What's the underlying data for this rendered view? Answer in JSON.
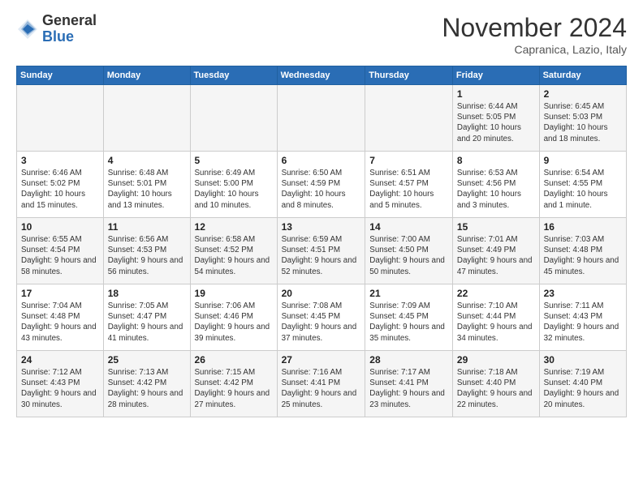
{
  "header": {
    "logo_general": "General",
    "logo_blue": "Blue",
    "month_title": "November 2024",
    "location": "Capranica, Lazio, Italy"
  },
  "days_of_week": [
    "Sunday",
    "Monday",
    "Tuesday",
    "Wednesday",
    "Thursday",
    "Friday",
    "Saturday"
  ],
  "weeks": [
    [
      {
        "day": "",
        "info": ""
      },
      {
        "day": "",
        "info": ""
      },
      {
        "day": "",
        "info": ""
      },
      {
        "day": "",
        "info": ""
      },
      {
        "day": "",
        "info": ""
      },
      {
        "day": "1",
        "info": "Sunrise: 6:44 AM\nSunset: 5:05 PM\nDaylight: 10 hours\nand 20 minutes."
      },
      {
        "day": "2",
        "info": "Sunrise: 6:45 AM\nSunset: 5:03 PM\nDaylight: 10 hours\nand 18 minutes."
      }
    ],
    [
      {
        "day": "3",
        "info": "Sunrise: 6:46 AM\nSunset: 5:02 PM\nDaylight: 10 hours\nand 15 minutes."
      },
      {
        "day": "4",
        "info": "Sunrise: 6:48 AM\nSunset: 5:01 PM\nDaylight: 10 hours\nand 13 minutes."
      },
      {
        "day": "5",
        "info": "Sunrise: 6:49 AM\nSunset: 5:00 PM\nDaylight: 10 hours\nand 10 minutes."
      },
      {
        "day": "6",
        "info": "Sunrise: 6:50 AM\nSunset: 4:59 PM\nDaylight: 10 hours\nand 8 minutes."
      },
      {
        "day": "7",
        "info": "Sunrise: 6:51 AM\nSunset: 4:57 PM\nDaylight: 10 hours\nand 5 minutes."
      },
      {
        "day": "8",
        "info": "Sunrise: 6:53 AM\nSunset: 4:56 PM\nDaylight: 10 hours\nand 3 minutes."
      },
      {
        "day": "9",
        "info": "Sunrise: 6:54 AM\nSunset: 4:55 PM\nDaylight: 10 hours\nand 1 minute."
      }
    ],
    [
      {
        "day": "10",
        "info": "Sunrise: 6:55 AM\nSunset: 4:54 PM\nDaylight: 9 hours\nand 58 minutes."
      },
      {
        "day": "11",
        "info": "Sunrise: 6:56 AM\nSunset: 4:53 PM\nDaylight: 9 hours\nand 56 minutes."
      },
      {
        "day": "12",
        "info": "Sunrise: 6:58 AM\nSunset: 4:52 PM\nDaylight: 9 hours\nand 54 minutes."
      },
      {
        "day": "13",
        "info": "Sunrise: 6:59 AM\nSunset: 4:51 PM\nDaylight: 9 hours\nand 52 minutes."
      },
      {
        "day": "14",
        "info": "Sunrise: 7:00 AM\nSunset: 4:50 PM\nDaylight: 9 hours\nand 50 minutes."
      },
      {
        "day": "15",
        "info": "Sunrise: 7:01 AM\nSunset: 4:49 PM\nDaylight: 9 hours\nand 47 minutes."
      },
      {
        "day": "16",
        "info": "Sunrise: 7:03 AM\nSunset: 4:48 PM\nDaylight: 9 hours\nand 45 minutes."
      }
    ],
    [
      {
        "day": "17",
        "info": "Sunrise: 7:04 AM\nSunset: 4:48 PM\nDaylight: 9 hours\nand 43 minutes."
      },
      {
        "day": "18",
        "info": "Sunrise: 7:05 AM\nSunset: 4:47 PM\nDaylight: 9 hours\nand 41 minutes."
      },
      {
        "day": "19",
        "info": "Sunrise: 7:06 AM\nSunset: 4:46 PM\nDaylight: 9 hours\nand 39 minutes."
      },
      {
        "day": "20",
        "info": "Sunrise: 7:08 AM\nSunset: 4:45 PM\nDaylight: 9 hours\nand 37 minutes."
      },
      {
        "day": "21",
        "info": "Sunrise: 7:09 AM\nSunset: 4:45 PM\nDaylight: 9 hours\nand 35 minutes."
      },
      {
        "day": "22",
        "info": "Sunrise: 7:10 AM\nSunset: 4:44 PM\nDaylight: 9 hours\nand 34 minutes."
      },
      {
        "day": "23",
        "info": "Sunrise: 7:11 AM\nSunset: 4:43 PM\nDaylight: 9 hours\nand 32 minutes."
      }
    ],
    [
      {
        "day": "24",
        "info": "Sunrise: 7:12 AM\nSunset: 4:43 PM\nDaylight: 9 hours\nand 30 minutes."
      },
      {
        "day": "25",
        "info": "Sunrise: 7:13 AM\nSunset: 4:42 PM\nDaylight: 9 hours\nand 28 minutes."
      },
      {
        "day": "26",
        "info": "Sunrise: 7:15 AM\nSunset: 4:42 PM\nDaylight: 9 hours\nand 27 minutes."
      },
      {
        "day": "27",
        "info": "Sunrise: 7:16 AM\nSunset: 4:41 PM\nDaylight: 9 hours\nand 25 minutes."
      },
      {
        "day": "28",
        "info": "Sunrise: 7:17 AM\nSunset: 4:41 PM\nDaylight: 9 hours\nand 23 minutes."
      },
      {
        "day": "29",
        "info": "Sunrise: 7:18 AM\nSunset: 4:40 PM\nDaylight: 9 hours\nand 22 minutes."
      },
      {
        "day": "30",
        "info": "Sunrise: 7:19 AM\nSunset: 4:40 PM\nDaylight: 9 hours\nand 20 minutes."
      }
    ]
  ]
}
